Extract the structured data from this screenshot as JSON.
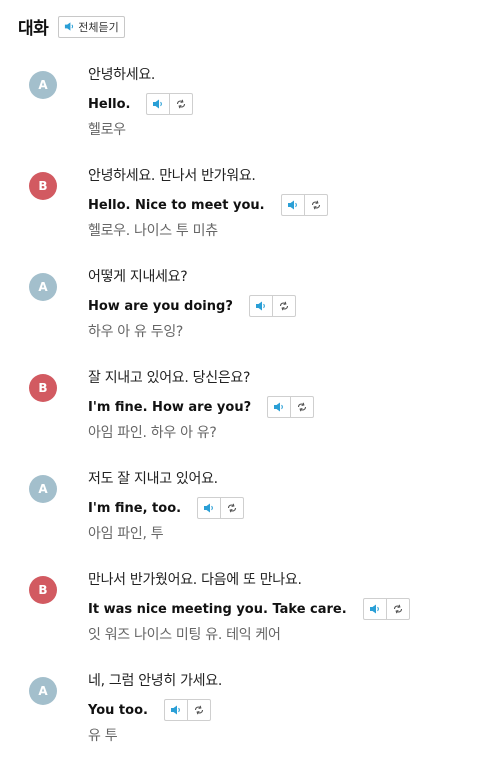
{
  "header": {
    "title": "대화",
    "listen_all_label": "전체듣기"
  },
  "icons": {
    "speaker": "speaker-icon",
    "repeat": "repeat-icon"
  },
  "colors": {
    "speaker_a": "#a3bfcc",
    "speaker_b": "#d25a61",
    "icon_accent": "#2a9fd6"
  },
  "dialogue": [
    {
      "speaker": "A",
      "korean": "안녕하세요.",
      "english": "Hello.",
      "pronunciation": "헬로우"
    },
    {
      "speaker": "B",
      "korean": "안녕하세요. 만나서 반가워요.",
      "english": "Hello. Nice to meet you.",
      "pronunciation": "헬로우. 나이스 투 미츄"
    },
    {
      "speaker": "A",
      "korean": "어떻게 지내세요?",
      "english": "How are you doing?",
      "pronunciation": "하우 아 유 두잉?"
    },
    {
      "speaker": "B",
      "korean": "잘 지내고 있어요. 당신은요?",
      "english": "I'm fine. How are you?",
      "pronunciation": "아임 파인. 하우 아 유?"
    },
    {
      "speaker": "A",
      "korean": "저도 잘 지내고 있어요.",
      "english": "I'm fine, too.",
      "pronunciation": "아임 파인, 투"
    },
    {
      "speaker": "B",
      "korean": "만나서 반가웠어요. 다음에 또 만나요.",
      "english": "It was nice meeting you. Take care.",
      "pronunciation": "잇 워즈 나이스 미팅 유. 테익 케어"
    },
    {
      "speaker": "A",
      "korean": "네, 그럼 안녕히 가세요.",
      "english": "You too.",
      "pronunciation": "유 투"
    }
  ]
}
